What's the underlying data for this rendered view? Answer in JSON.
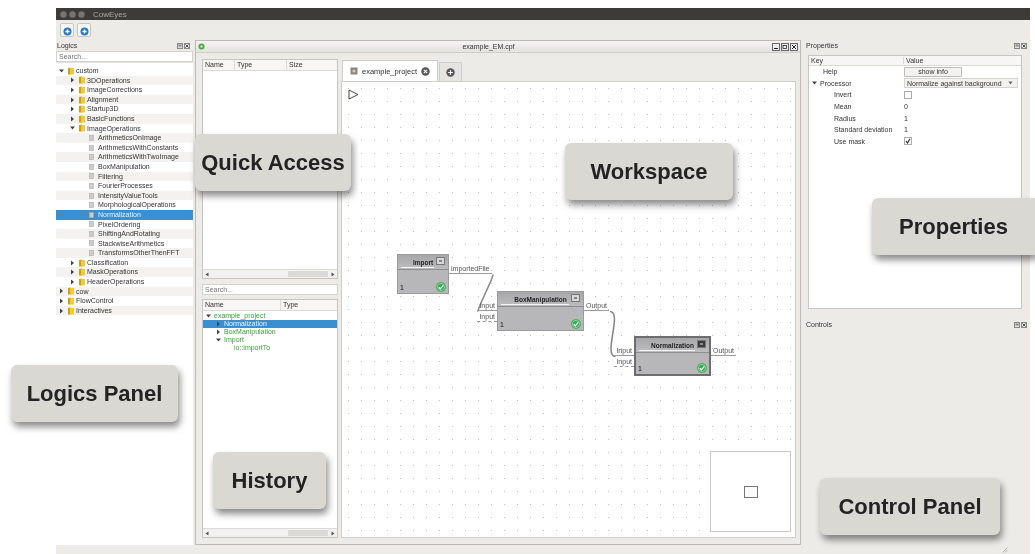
{
  "window": {
    "title": "CowEyes"
  },
  "logics_panel": {
    "title": "Logics",
    "search": {
      "placeholder": "Search..."
    },
    "tree": [
      {
        "label": "custom",
        "kind": "folder",
        "expanded": true,
        "selected": false,
        "children": [
          {
            "label": "3DOperations",
            "kind": "folder",
            "expanded": false,
            "selected": false
          },
          {
            "label": "ImageCorrections",
            "kind": "folder",
            "expanded": false,
            "selected": false
          },
          {
            "label": "Alignment",
            "kind": "folder",
            "expanded": false,
            "selected": false
          },
          {
            "label": "Startup3D",
            "kind": "folder",
            "expanded": false,
            "selected": false
          },
          {
            "label": "BasicFunctions",
            "kind": "folder",
            "expanded": false,
            "selected": false
          },
          {
            "label": "ImageOperations",
            "kind": "folder",
            "expanded": true,
            "selected": false,
            "children": [
              {
                "label": "ArithmeticsOnImage",
                "kind": "file",
                "selected": false
              },
              {
                "label": "ArithmeticsWithConstants",
                "kind": "file",
                "selected": false
              },
              {
                "label": "ArithmeticsWithTwoImage",
                "kind": "file",
                "selected": false
              },
              {
                "label": "BoxManipulation",
                "kind": "file",
                "selected": false
              },
              {
                "label": "Filtering",
                "kind": "file",
                "selected": false
              },
              {
                "label": "FourierProcesses",
                "kind": "file",
                "selected": false
              },
              {
                "label": "IntensityValueTools",
                "kind": "file",
                "selected": false
              },
              {
                "label": "MorphologicalOperations",
                "kind": "file",
                "selected": false
              },
              {
                "label": "Normalization",
                "kind": "file",
                "selected": true
              },
              {
                "label": "PixelOrdering",
                "kind": "file",
                "selected": false
              },
              {
                "label": "ShiftingAndRotating",
                "kind": "file",
                "selected": false
              },
              {
                "label": "StackwiseArithmetics",
                "kind": "file",
                "selected": false
              },
              {
                "label": "TransformsOtherThenFFT",
                "kind": "file",
                "selected": false
              }
            ]
          },
          {
            "label": "Classification",
            "kind": "folder",
            "expanded": false,
            "selected": false
          },
          {
            "label": "MaskOperations",
            "kind": "folder",
            "expanded": false,
            "selected": false
          },
          {
            "label": "HeaderOperations",
            "kind": "folder",
            "expanded": false,
            "selected": false
          }
        ]
      },
      {
        "label": "cow",
        "kind": "folder",
        "expanded": false,
        "selected": false
      },
      {
        "label": "FlowControl",
        "kind": "folder",
        "expanded": false,
        "selected": false
      },
      {
        "label": "Interactives",
        "kind": "folder",
        "expanded": false,
        "selected": false
      }
    ]
  },
  "project_window": {
    "title": "example_EM.cpf",
    "files": {
      "columns": [
        "Name",
        "Type",
        "Size"
      ]
    },
    "history": {
      "search": {
        "placeholder": "Search..."
      },
      "columns": [
        "Name",
        "Type"
      ],
      "tree": [
        {
          "label": "example_project",
          "expanded": true,
          "selected": false,
          "children": [
            {
              "label": "Normalization",
              "expanded": false,
              "selected": true
            },
            {
              "label": "BoxManipulation",
              "expanded": false,
              "selected": false
            },
            {
              "label": "Import",
              "expanded": true,
              "selected": false,
              "children": [
                {
                  "label": "io::importTo",
                  "selected": false
                }
              ]
            }
          ]
        }
      ]
    },
    "tabs": [
      {
        "kind": "project",
        "label": "example_project",
        "selected": true
      },
      {
        "kind": "add",
        "selected": false
      }
    ],
    "nodes": [
      {
        "title": "Import",
        "count": "1",
        "selected": false,
        "outputs": [
          "importedFile"
        ]
      },
      {
        "title": "BoxManipulation",
        "count": "1",
        "selected": false,
        "inputs": [
          "Input",
          "Input"
        ],
        "outputs": [
          "Output"
        ]
      },
      {
        "title": "Normalization",
        "count": "1",
        "selected": true,
        "inputs": [
          "Input",
          "Input"
        ],
        "outputs": [
          "Output"
        ]
      }
    ]
  },
  "properties_panel": {
    "title": "Properties",
    "columns": [
      "Key",
      "Value"
    ],
    "rows": [
      {
        "key": "Help",
        "kind": "button",
        "value": "show info"
      },
      {
        "key": "Processor",
        "kind": "dropdown",
        "value": "Normalize against background",
        "expanded": true,
        "children": [
          {
            "key": "Invert",
            "kind": "checkbox",
            "checked": false
          },
          {
            "key": "Mean",
            "kind": "text",
            "value": "0"
          },
          {
            "key": "Radius",
            "kind": "text",
            "value": "1"
          },
          {
            "key": "Standard deviation",
            "kind": "text",
            "value": "1"
          },
          {
            "key": "Use mask",
            "kind": "checkbox",
            "checked": true
          }
        ]
      }
    ]
  },
  "controls_panel": {
    "title": "Controls"
  },
  "callouts": [
    {
      "text": "Quick Access"
    },
    {
      "text": "Workspace"
    },
    {
      "text": "Properties"
    },
    {
      "text": "Logics Panel"
    },
    {
      "text": "History"
    },
    {
      "text": "Control Panel"
    }
  ]
}
